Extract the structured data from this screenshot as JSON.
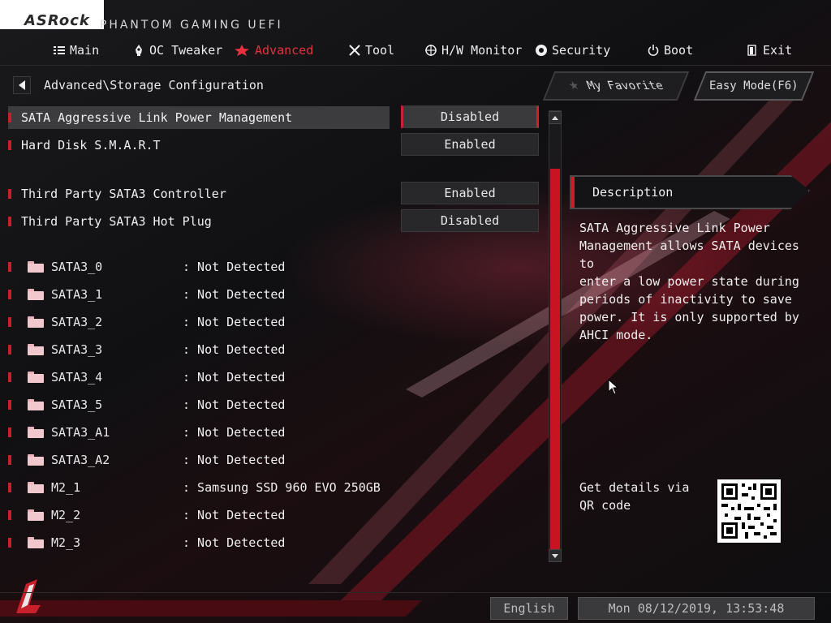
{
  "brand": {
    "logo": "ASRock",
    "subtitle": "PHANTOM GAMING UEFI"
  },
  "nav": {
    "items": [
      {
        "label": "Main",
        "icon": "list-icon"
      },
      {
        "label": "OC Tweaker",
        "icon": "rocket-icon"
      },
      {
        "label": "Advanced",
        "icon": "star-icon",
        "active": true
      },
      {
        "label": "Tool",
        "icon": "tools-icon"
      },
      {
        "label": "H/W Monitor",
        "icon": "monitor-icon"
      },
      {
        "label": "Security",
        "icon": "shield-icon"
      },
      {
        "label": "Boot",
        "icon": "power-icon"
      },
      {
        "label": "Exit",
        "icon": "exit-icon"
      }
    ]
  },
  "breadcrumb": "Advanced\\Storage Configuration",
  "buttons": {
    "favorite": "My Favorite",
    "easy_mode": "Easy Mode(F6)"
  },
  "settings": [
    {
      "label": "SATA Aggressive Link Power Management",
      "value": "Disabled",
      "selected": true
    },
    {
      "label": "Hard Disk S.M.A.R.T",
      "value": "Enabled"
    },
    {
      "label": "Third Party SATA3 Controller",
      "value": "Enabled"
    },
    {
      "label": "Third Party SATA3 Hot Plug",
      "value": "Disabled"
    }
  ],
  "drives": [
    {
      "name": "SATA3_0",
      "value": ": Not Detected"
    },
    {
      "name": "SATA3_1",
      "value": ": Not Detected"
    },
    {
      "name": "SATA3_2",
      "value": ": Not Detected"
    },
    {
      "name": "SATA3_3",
      "value": ": Not Detected"
    },
    {
      "name": "SATA3_4",
      "value": ": Not Detected"
    },
    {
      "name": "SATA3_5",
      "value": ": Not Detected"
    },
    {
      "name": "SATA3_A1",
      "value": ": Not Detected"
    },
    {
      "name": "SATA3_A2",
      "value": ": Not Detected"
    },
    {
      "name": "M2_1",
      "value": ": Samsung SSD 960 EVO 250GB"
    },
    {
      "name": "M2_2",
      "value": ": Not Detected"
    },
    {
      "name": "M2_3",
      "value": ": Not Detected"
    }
  ],
  "description": {
    "title": "Description",
    "text": "SATA Aggressive Link Power\nManagement allows SATA devices to\nenter a low power state during\nperiods of inactivity to save\npower. It is only supported by\nAHCI mode.",
    "qr_text": "Get details via QR code"
  },
  "footer": {
    "language": "English",
    "datetime": "Mon 08/12/2019, 13:53:48"
  },
  "colors": {
    "accent": "#c8202a",
    "active_tab": "#e8303c",
    "background": "#0d0d0f"
  }
}
